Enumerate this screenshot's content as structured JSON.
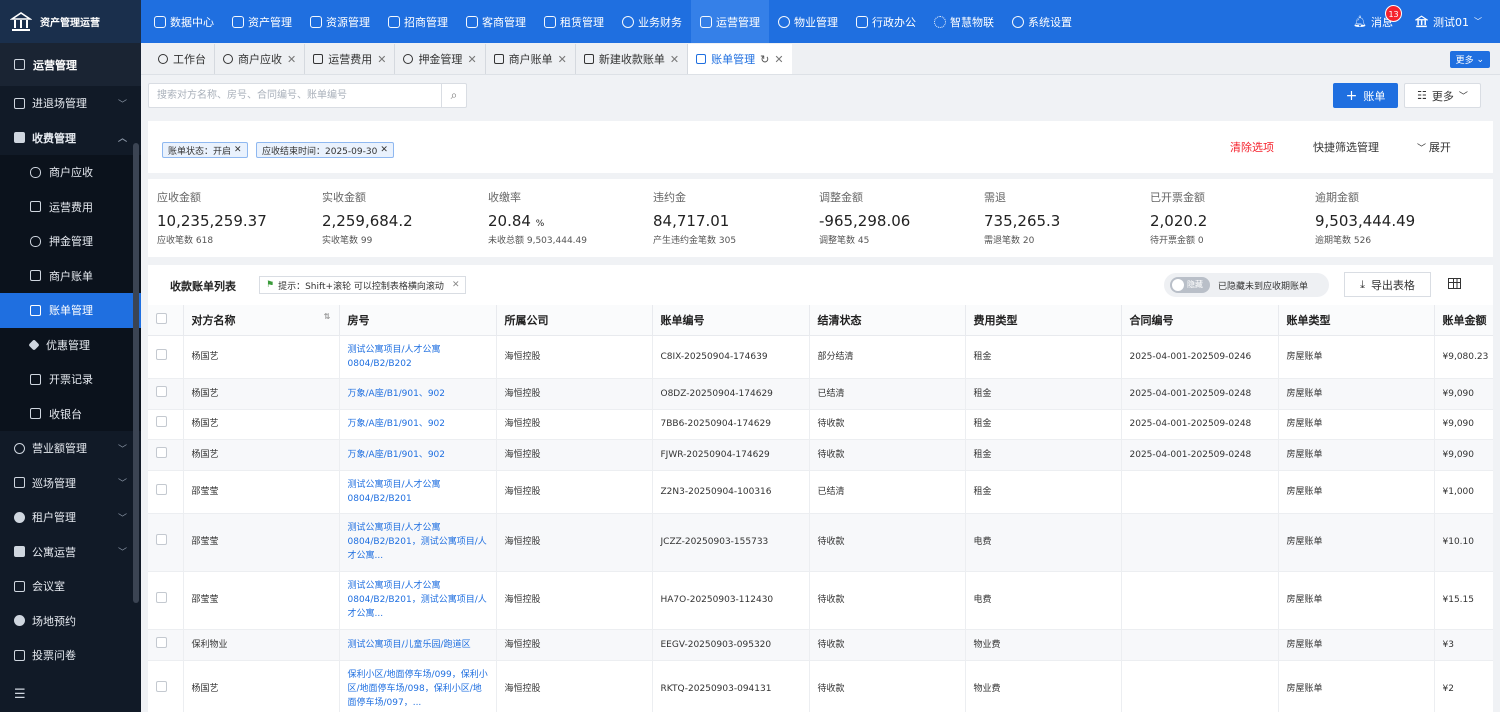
{
  "brand": {
    "title": "资产管理运营"
  },
  "topnav": {
    "items": [
      {
        "label": "数据中心"
      },
      {
        "label": "资产管理"
      },
      {
        "label": "资源管理"
      },
      {
        "label": "招商管理"
      },
      {
        "label": "客商管理"
      },
      {
        "label": "租赁管理"
      },
      {
        "label": "业务财务"
      },
      {
        "label": "运营管理"
      },
      {
        "label": "物业管理"
      },
      {
        "label": "行政办公"
      },
      {
        "label": "智慧物联"
      },
      {
        "label": "系统设置"
      }
    ],
    "active_index": 7,
    "message_label": "消息",
    "message_count": "13",
    "user_name": "测试01"
  },
  "sidebar": {
    "header": "运营管理",
    "items": [
      {
        "label": "进退场管理",
        "caret": "﹀"
      },
      {
        "label": "收费管理",
        "caret": "︿"
      },
      {
        "label": "商户应收"
      },
      {
        "label": "运营费用"
      },
      {
        "label": "押金管理"
      },
      {
        "label": "商户账单"
      },
      {
        "label": "账单管理"
      },
      {
        "label": "优惠管理"
      },
      {
        "label": "开票记录"
      },
      {
        "label": "收银台"
      },
      {
        "label": "营业额管理",
        "caret": "﹀"
      },
      {
        "label": "巡场管理",
        "caret": "﹀"
      },
      {
        "label": "租户管理",
        "caret": "﹀"
      },
      {
        "label": "公寓运营",
        "caret": "﹀"
      },
      {
        "label": "会议室"
      },
      {
        "label": "场地预约"
      },
      {
        "label": "投票问卷"
      }
    ]
  },
  "tabs": {
    "items": [
      {
        "label": "工作台"
      },
      {
        "label": "商户应收"
      },
      {
        "label": "运营费用"
      },
      {
        "label": "押金管理"
      },
      {
        "label": "商户账单"
      },
      {
        "label": "新建收款账单"
      },
      {
        "label": "账单管理"
      }
    ],
    "more_label": "更多"
  },
  "toolbar": {
    "search_placeholder": "搜索对方名称、房号、合同编号、账单编号",
    "add_label": "账单",
    "more_label": "更多"
  },
  "filters": {
    "chips": [
      {
        "label": "账单状态：开启"
      },
      {
        "label": "应收结束时间：2025-09-30"
      }
    ],
    "clear_label": "清除选项",
    "quick_label": "快捷筛选管理",
    "expand_label": "展开"
  },
  "stats": [
    {
      "label": "应收金额",
      "value": "10,235,259.37",
      "unit": "",
      "sub": "应收笔数 618"
    },
    {
      "label": "实收金额",
      "value": "2,259,684.2",
      "unit": "",
      "sub": "实收笔数 99"
    },
    {
      "label": "收缴率",
      "value": "20.84",
      "unit": "%",
      "sub": "未收总额 9,503,444.49"
    },
    {
      "label": "违约金",
      "value": "84,717.01",
      "unit": "",
      "sub": "产生违约金笔数 305"
    },
    {
      "label": "调整金额",
      "value": "-965,298.06",
      "unit": "",
      "sub": "调整笔数 45"
    },
    {
      "label": "需退",
      "value": "735,265.3",
      "unit": "",
      "sub": "需退笔数 20"
    },
    {
      "label": "已开票金额",
      "value": "2,020.2",
      "unit": "",
      "sub": "待开票金额 0"
    },
    {
      "label": "逾期金额",
      "value": "9,503,444.49",
      "unit": "",
      "sub": "逾期笔数 526"
    }
  ],
  "table": {
    "title": "收款账单列表",
    "tip": "提示：Shift+滚轮 可以控制表格横向滚动",
    "toggle_label": "隐藏",
    "toggle_text": "已隐藏未到应收期账单",
    "export_label": "导出表格",
    "columns": [
      "对方名称",
      "房号",
      "所属公司",
      "账单编号",
      "结清状态",
      "费用类型",
      "合同编号",
      "账单类型",
      "账单金额"
    ],
    "rows": [
      {
        "name": "杨国艺",
        "room": "测试公寓项目/人才公寓0804/B2/B202",
        "company": "海恒控股",
        "bill_no": "C8IX-20250904-174639",
        "status": "部分结清",
        "fee": "租金",
        "contract": "2025-04-001-202509-0246",
        "type": "房屋账单",
        "amount": "¥9,080.23"
      },
      {
        "name": "杨国艺",
        "room": "万象/A座/B1/901、902",
        "company": "海恒控股",
        "bill_no": "O8DZ-20250904-174629",
        "status": "已结清",
        "fee": "租金",
        "contract": "2025-04-001-202509-0248",
        "type": "房屋账单",
        "amount": "¥9,090"
      },
      {
        "name": "杨国艺",
        "room": "万象/A座/B1/901、902",
        "company": "海恒控股",
        "bill_no": "7BB6-20250904-174629",
        "status": "待收款",
        "fee": "租金",
        "contract": "2025-04-001-202509-0248",
        "type": "房屋账单",
        "amount": "¥9,090"
      },
      {
        "name": "杨国艺",
        "room": "万象/A座/B1/901、902",
        "company": "海恒控股",
        "bill_no": "FJWR-20250904-174629",
        "status": "待收款",
        "fee": "租金",
        "contract": "2025-04-001-202509-0248",
        "type": "房屋账单",
        "amount": "¥9,090"
      },
      {
        "name": "邵莹莹",
        "room": "测试公寓项目/人才公寓0804/B2/B201",
        "company": "海恒控股",
        "bill_no": "Z2N3-20250904-100316",
        "status": "已结清",
        "fee": "租金",
        "contract": "",
        "type": "房屋账单",
        "amount": "¥1,000"
      },
      {
        "name": "邵莹莹",
        "room": "测试公寓项目/人才公寓0804/B2/B201，测试公寓项目/人才公寓...",
        "company": "海恒控股",
        "bill_no": "JCZZ-20250903-155733",
        "status": "待收款",
        "fee": "电费",
        "contract": "",
        "type": "房屋账单",
        "amount": "¥10.10"
      },
      {
        "name": "邵莹莹",
        "room": "测试公寓项目/人才公寓0804/B2/B201，测试公寓项目/人才公寓...",
        "company": "海恒控股",
        "bill_no": "HA7O-20250903-112430",
        "status": "待收款",
        "fee": "电费",
        "contract": "",
        "type": "房屋账单",
        "amount": "¥15.15"
      },
      {
        "name": "保利物业",
        "room": "测试公寓项目/儿童乐园/跑道区",
        "company": "海恒控股",
        "bill_no": "EEGV-20250903-095320",
        "status": "待收款",
        "fee": "物业费",
        "contract": "",
        "type": "房屋账单",
        "amount": "¥3"
      },
      {
        "name": "杨国艺",
        "room": "保利小区/地面停车场/099，保利小区/地面停车场/098，保利小区/地面停车场/097，...",
        "company": "海恒控股",
        "bill_no": "RKTQ-20250903-094131",
        "status": "待收款",
        "fee": "物业费",
        "contract": "",
        "type": "房屋账单",
        "amount": "¥2"
      }
    ]
  },
  "colors": {
    "primary": "#1f6fe0",
    "sidebar_bg": "#111a27",
    "danger": "#f5222d"
  }
}
